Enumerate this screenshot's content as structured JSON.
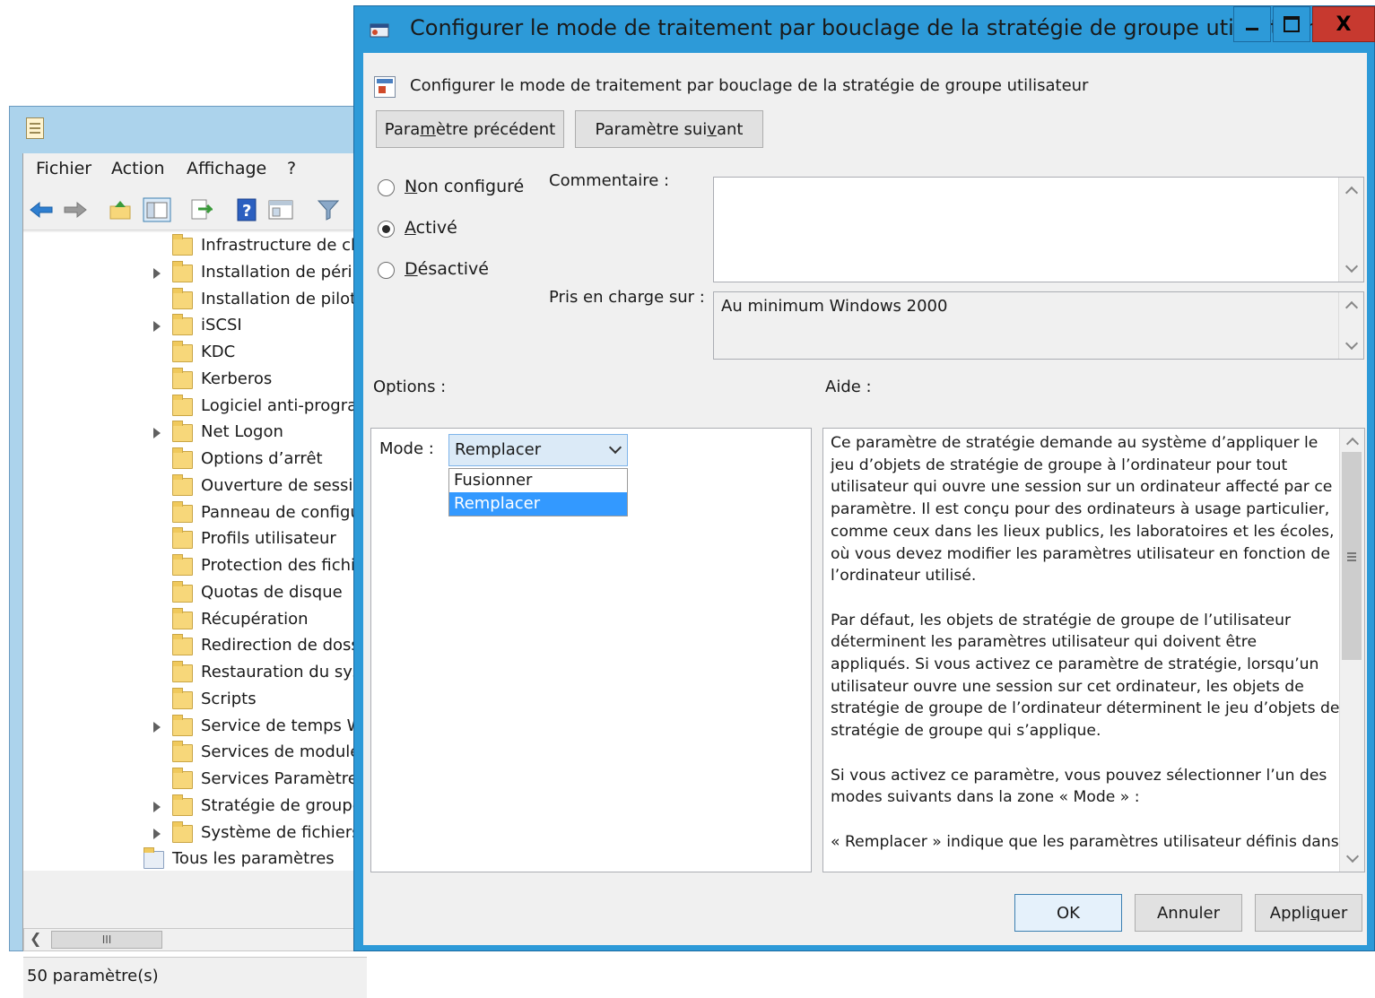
{
  "background_window": {
    "menu": [
      "Fichier",
      "Action",
      "Affichage",
      "?"
    ],
    "tree": [
      {
        "label": "Infrastructure de cla",
        "expandable": false
      },
      {
        "label": "Installation de périp",
        "expandable": true
      },
      {
        "label": "Installation de pilote",
        "expandable": false
      },
      {
        "label": "iSCSI",
        "expandable": true
      },
      {
        "label": "KDC",
        "expandable": false
      },
      {
        "label": "Kerberos",
        "expandable": false
      },
      {
        "label": "Logiciel anti-progra",
        "expandable": false
      },
      {
        "label": "Net Logon",
        "expandable": true
      },
      {
        "label": "Options d’arrêt",
        "expandable": false
      },
      {
        "label": "Ouverture de sessio",
        "expandable": false
      },
      {
        "label": "Panneau de configu",
        "expandable": false
      },
      {
        "label": "Profils utilisateur",
        "expandable": false
      },
      {
        "label": "Protection des fichi",
        "expandable": false
      },
      {
        "label": "Quotas de disque",
        "expandable": false
      },
      {
        "label": "Récupération",
        "expandable": false
      },
      {
        "label": "Redirection de doss",
        "expandable": false
      },
      {
        "label": "Restauration du sys",
        "expandable": false
      },
      {
        "label": "Scripts",
        "expandable": false
      },
      {
        "label": "Service de temps W",
        "expandable": true
      },
      {
        "label": "Services de module",
        "expandable": false
      },
      {
        "label": "Services Paramètres",
        "expandable": false
      },
      {
        "label": "Stratégie de groupe",
        "expandable": true
      },
      {
        "label": "Système de fichiers",
        "expandable": true
      },
      {
        "label": "Tous les paramètres",
        "expandable": false,
        "special": true
      }
    ],
    "hscroll_thumb": "III",
    "status": "50 paramètre(s)"
  },
  "dialog": {
    "title": "Configurer le mode de traitement par bouclage de la stratégie de groupe utilisateur",
    "subtitle": "Configurer le mode de traitement par bouclage de la stratégie de groupe utilisateur",
    "btn_prev": {
      "pre": "Para",
      "ul": "m",
      "post": "ètre précédent"
    },
    "btn_next": {
      "pre": "Paramètre sui",
      "ul": "v",
      "post": "ant"
    },
    "radios": [
      {
        "ul": "N",
        "post": "on configuré",
        "checked": false
      },
      {
        "ul": "A",
        "post": "ctivé",
        "checked": true
      },
      {
        "ul": "D",
        "post": "ésactivé",
        "checked": false
      }
    ],
    "comment_label": "Commentaire :",
    "comment_value": "",
    "supported_label": "Pris en charge sur :",
    "supported_value": "Au minimum Windows 2000",
    "options_label": "Options :",
    "help_label": "Aide :",
    "mode_label": "Mode :",
    "mode_selected": "Remplacer",
    "mode_options": [
      "Fusionner",
      "Remplacer"
    ],
    "help_paragraphs": [
      "Ce paramètre de stratégie demande au système d’appliquer le jeu d’objets de stratégie de groupe à l’ordinateur pour tout utilisateur qui ouvre une session sur un ordinateur affecté par ce paramètre. Il est conçu pour des ordinateurs à usage particulier, comme ceux dans les lieux publics, les laboratoires et les écoles, où vous devez modifier les paramètres utilisateur en fonction de l’ordinateur utilisé.",
      "Par défaut, les objets de stratégie de groupe de l’utilisateur déterminent les paramètres utilisateur qui doivent être appliqués. Si vous activez ce paramètre de stratégie, lorsqu’un utilisateur ouvre une session sur cet ordinateur, les objets de stratégie de groupe de l’ordinateur déterminent le jeu d’objets de stratégie de groupe qui s’applique.",
      "Si vous activez ce paramètre, vous pouvez sélectionner l’un des modes suivants dans la zone « Mode » :",
      "« Remplacer » indique que les paramètres utilisateur définis dans"
    ],
    "ok_label": "OK",
    "cancel_label": "Annuler",
    "apply": {
      "pre": "Appli",
      "ul": "q",
      "post": "uer"
    },
    "close_glyph": "X"
  },
  "colors": {
    "titlebar": "#2d9ad8",
    "close": "#c7392f",
    "selection": "#3399ff",
    "folder": "#f7d77a"
  },
  "icons": [
    "app-icon",
    "back-arrow-icon",
    "forward-arrow-icon",
    "up-folder-icon",
    "show-tree-icon",
    "export-icon",
    "help-icon",
    "properties-icon",
    "filter-icon",
    "folder-icon",
    "expand-arrow-icon",
    "policy-icon",
    "minimize-icon",
    "maximize-icon",
    "close-icon",
    "chevron-up-icon",
    "chevron-down-icon"
  ]
}
